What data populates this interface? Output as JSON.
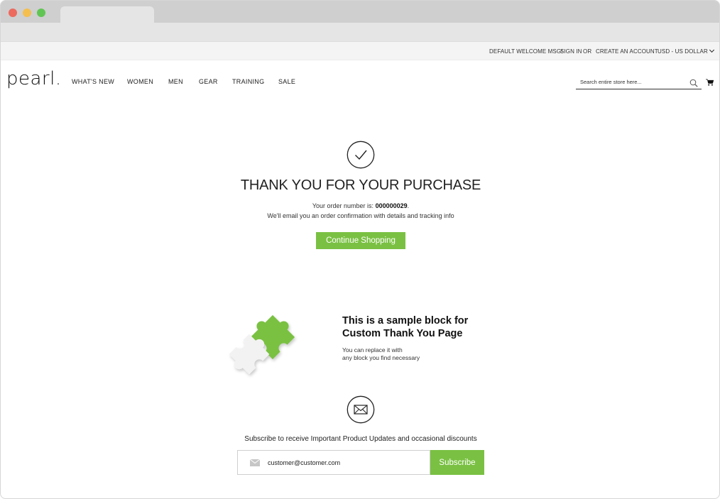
{
  "colors": {
    "accent": "#7ac143",
    "puzzle_white": "#f2f2f2"
  },
  "topbar": {
    "welcome": "DEFAULT WELCOME MSG!",
    "sign_in": "SIGN IN",
    "or": "OR",
    "create_account": "CREATE AN ACCOUNT",
    "currency": "USD - US DOLLAR"
  },
  "header": {
    "logo": "pearl.",
    "nav": [
      "WHAT'S NEW",
      "WOMEN",
      "MEN",
      "GEAR",
      "TRAINING",
      "SALE"
    ],
    "search_placeholder": "Search entire store here...",
    "icons": {
      "search": "search-icon",
      "cart": "cart-icon"
    }
  },
  "success": {
    "icon": "check-circle-icon",
    "title": "THANK YOU FOR YOUR PURCHASE",
    "order_prefix": "Your order number is: ",
    "order_number": "000000029",
    "order_suffix": ".",
    "email_note": "We'll email you an order confirmation with details and tracking info",
    "continue_label": "Continue Shopping"
  },
  "custom_block": {
    "icon": "puzzle-icon",
    "title_line1": "This is a sample block for",
    "title_line2": "Custom Thank You Page",
    "text_line1": "You can replace it with",
    "text_line2": "any block you find necessary"
  },
  "newsletter": {
    "icon": "mail-circle-icon",
    "text": "Subscribe to receive Important Product Updates and occasional discounts",
    "email_value": "customer@customer.com",
    "subscribe_label": "Subscribe"
  }
}
